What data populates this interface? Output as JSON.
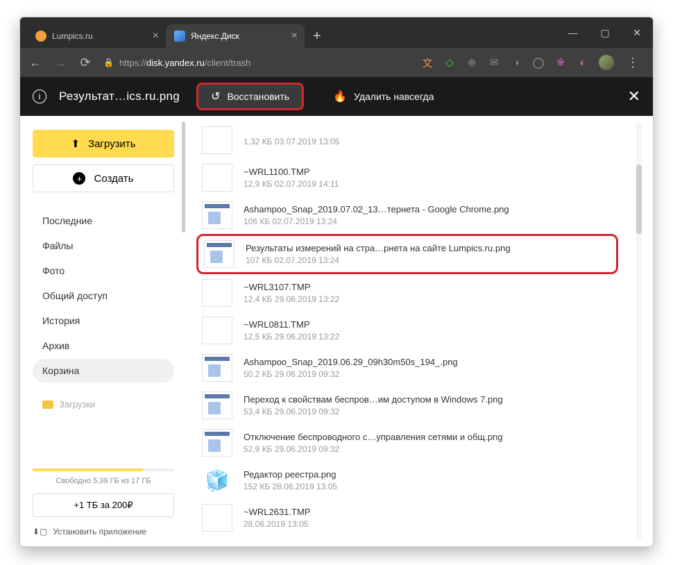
{
  "tabs": [
    {
      "title": "Lumpics.ru",
      "icon_color": "#f59f3b"
    },
    {
      "title": "Яндекс.Диск",
      "icon_color": "#4a8cff"
    }
  ],
  "url": {
    "prefix": "https://",
    "host": "disk.yandex.ru",
    "path": "/client/trash"
  },
  "actionbar": {
    "filename": "Результат…ics.ru.png",
    "restore": "Восстановить",
    "delete": "Удалить навсегда"
  },
  "sidebar": {
    "upload": "Загрузить",
    "create": "Создать",
    "nav": [
      "Последние",
      "Файлы",
      "Фото",
      "Общий доступ",
      "История",
      "Архив",
      "Корзина"
    ],
    "nav_selected": 6,
    "folder": "Загрузки",
    "quota_text": "Свободно 5,39 ГБ из 17 ГБ",
    "buy": "+1 ТБ за 200₽",
    "install": "Установить приложение"
  },
  "files": [
    {
      "name": "",
      "size": "1,32 КБ",
      "date": "03.07.2019",
      "time": "13:05",
      "thumb": "blank"
    },
    {
      "name": "~WRL1100.TMP",
      "size": "12,9 КБ",
      "date": "02.07.2019",
      "time": "14:11",
      "thumb": "blank"
    },
    {
      "name": "Ashampoo_Snap_2019.07.02_13…тернета - Google Chrome.png",
      "size": "106 КБ",
      "date": "02.07.2019",
      "time": "13:24",
      "thumb": "img"
    },
    {
      "name": "Результаты измерений на стра…рнета на сайте Lumpics.ru.png",
      "size": "107 КБ",
      "date": "02.07.2019",
      "time": "13:24",
      "thumb": "img",
      "selected": true
    },
    {
      "name": "~WRL3107.TMP",
      "size": "12,4 КБ",
      "date": "29.06.2019",
      "time": "13:22",
      "thumb": "blank"
    },
    {
      "name": "~WRL0811.TMP",
      "size": "12,5 КБ",
      "date": "29.06.2019",
      "time": "13:22",
      "thumb": "blank"
    },
    {
      "name": "Ashampoo_Snap_2019.06.29_09h30m50s_194_.png",
      "size": "50,2 КБ",
      "date": "29.06.2019",
      "time": "09:32",
      "thumb": "img"
    },
    {
      "name": "Переход к свойствам беспров…им доступом в Windows 7.png",
      "size": "53,4 КБ",
      "date": "29.06.2019",
      "time": "09:32",
      "thumb": "img"
    },
    {
      "name": "Отключение беспроводного с…управления сетями и общ.png",
      "size": "52,9 КБ",
      "date": "29.06.2019",
      "time": "09:32",
      "thumb": "img"
    },
    {
      "name": "Редактор реестра.png",
      "size": "152 КБ",
      "date": "28.06.2019",
      "time": "13:05",
      "thumb": "cube"
    },
    {
      "name": "~WRL2631.TMP",
      "size": "",
      "date": "28.06.2019",
      "time": "13:05",
      "thumb": "blank"
    }
  ]
}
